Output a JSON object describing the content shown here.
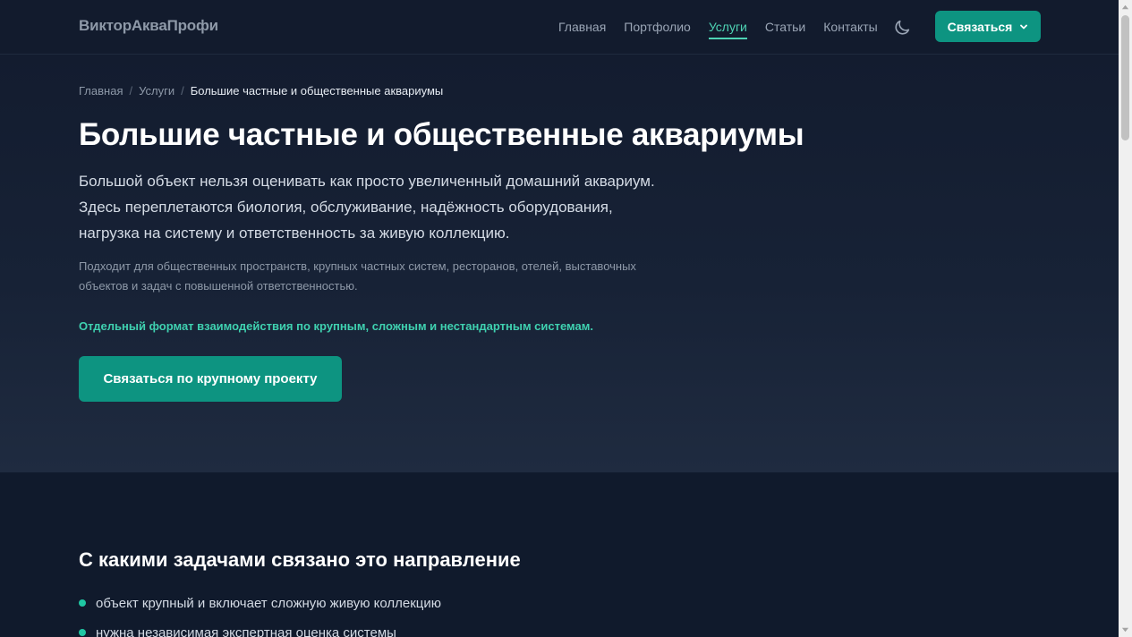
{
  "header": {
    "logo": "ВикторАкваПрофи",
    "nav": [
      "Главная",
      "Портфолио",
      "Услуги",
      "Статьи",
      "Контакты"
    ],
    "active_nav": "Услуги",
    "theme_toggle_icon": "moon-icon",
    "contact_button": "Связаться",
    "contact_button_icon": "chevron-down-icon"
  },
  "breadcrumb": {
    "items": [
      "Главная",
      "Услуги"
    ],
    "current": "Большие частные и общественные аквариумы",
    "separator": "/"
  },
  "hero": {
    "title": "Большие частные и общественные аквариумы",
    "lead": "Большой объект нельзя оценивать как просто увеличенный домашний аквариум. Здесь переплетаются биология, обслуживание, надёжность оборудования, нагрузка на систему и ответственность за живую коллекцию.",
    "note": "Подходит для общественных пространств, крупных частных систем, ресторанов, отелей, выставочных объектов и задач с повышенной ответственностью.",
    "accent": "Отдельный формат взаимодействия по крупным, сложным и нестандартным системам.",
    "cta": "Связаться по крупному проекту"
  },
  "section": {
    "title": "С какими задачами связано это направление",
    "items": [
      "объект крупный и включает сложную живую коллекцию",
      "нужна независимая экспертная оценка системы"
    ]
  },
  "colors": {
    "accent": "#0d9481",
    "accent_text": "#3fd1b0",
    "background": "#101a2c"
  }
}
